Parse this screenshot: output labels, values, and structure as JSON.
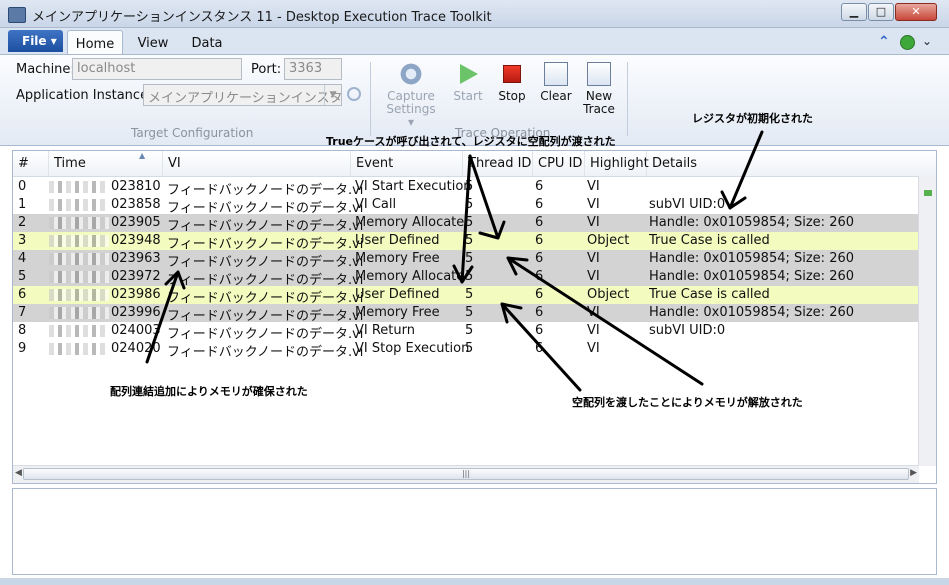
{
  "window": {
    "title": "メインアプリケーションインスタンス 11 - Desktop Execution Trace Toolkit",
    "controls": {
      "minimize": "▁",
      "maximize": "□",
      "close": "✕"
    }
  },
  "tabs": {
    "file": "File ▾",
    "home": "Home",
    "view": "View",
    "data": "Data"
  },
  "config": {
    "machine_label": "Machine:",
    "machine_value": "localhost",
    "port_label": "Port:",
    "port_value": "3363",
    "instance_label": "Application Instance:",
    "instance_value": "メインアプリケーションインスタ",
    "group_caption": "Target Configuration"
  },
  "operations": {
    "capture_settings": "Capture Settings ▾",
    "start": "Start",
    "stop": "Stop",
    "clear": "Clear",
    "new_trace": "New Trace",
    "group_caption": "Trace Operation"
  },
  "columns": [
    "#",
    "Time",
    "VI",
    "Event",
    "Thread ID",
    "CPU ID",
    "Highlight",
    "Details"
  ],
  "rows": [
    {
      "num": "0",
      "time": "023810",
      "vi": "フィードバックノードのデータ.vi",
      "event": "VI Start Execution",
      "thread": "5",
      "cpu": "6",
      "highlight": "VI",
      "details": "",
      "style": "white"
    },
    {
      "num": "1",
      "time": "023858",
      "vi": "フィードバックノードのデータ.vi",
      "event": "VI Call",
      "thread": "5",
      "cpu": "6",
      "highlight": "VI",
      "details": "subVI UID:0",
      "style": "white"
    },
    {
      "num": "2",
      "time": "023905",
      "vi": "フィードバックノードのデータ.vi",
      "event": "Memory Allocate",
      "thread": "5",
      "cpu": "6",
      "highlight": "VI",
      "details": "Handle: 0x01059854; Size: 260",
      "style": "gray"
    },
    {
      "num": "3",
      "time": "023948",
      "vi": "フィードバックノードのデータ.vi",
      "event": "User Defined",
      "thread": "5",
      "cpu": "6",
      "highlight": "Object",
      "details": "True Case is called",
      "style": "yellow"
    },
    {
      "num": "4",
      "time": "023963",
      "vi": "フィードバックノードのデータ.vi",
      "event": "Memory Free",
      "thread": "5",
      "cpu": "6",
      "highlight": "VI",
      "details": "Handle: 0x01059854; Size: 260",
      "style": "gray"
    },
    {
      "num": "5",
      "time": "023972",
      "vi": "フィードバックノードのデータ.vi",
      "event": "Memory Allocate",
      "thread": "5",
      "cpu": "6",
      "highlight": "VI",
      "details": "Handle: 0x01059854; Size: 260",
      "style": "gray"
    },
    {
      "num": "6",
      "time": "023986",
      "vi": "フィードバックノードのデータ.vi",
      "event": "User Defined",
      "thread": "5",
      "cpu": "6",
      "highlight": "Object",
      "details": "True Case is called",
      "style": "yellow"
    },
    {
      "num": "7",
      "time": "023996",
      "vi": "フィードバックノードのデータ.vi",
      "event": "Memory Free",
      "thread": "5",
      "cpu": "6",
      "highlight": "VI",
      "details": "Handle: 0x01059854; Size: 260",
      "style": "gray"
    },
    {
      "num": "8",
      "time": "024003",
      "vi": "フィードバックノードのデータ.vi",
      "event": "VI Return",
      "thread": "5",
      "cpu": "6",
      "highlight": "VI",
      "details": "subVI UID:0",
      "style": "white"
    },
    {
      "num": "9",
      "time": "024020",
      "vi": "フィードバックノードのデータ.vi",
      "event": "VI Stop Execution",
      "thread": "5",
      "cpu": "6",
      "highlight": "VI",
      "details": "",
      "style": "white"
    }
  ],
  "annotations": {
    "register_init": "レジスタが初期化された",
    "true_case": "Trueケースが呼び出されて、レジスタに空配列が渡された",
    "concat_alloc": "配列連結追加によりメモリが確保された",
    "free_empty": "空配列を渡したことによりメモリが解放された"
  }
}
